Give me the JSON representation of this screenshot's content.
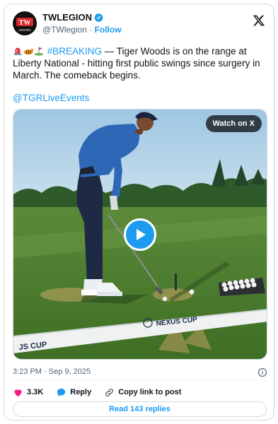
{
  "author": {
    "display_name": "TWLEGION",
    "handle": "@TWlegion",
    "separator": "·",
    "follow_label": "Follow",
    "avatar_lines": [
      "TW",
      "LEGION"
    ]
  },
  "tweet": {
    "hashtag": "#BREAKING",
    "body": " — Tiger Woods is on the range at Liberty National - hitting first public swings since surgery in March. The comeback begins.",
    "mention": "@TGRLiveEvents",
    "emojis": [
      "rotating-light-icon",
      "tiger-icon",
      "golf-flag-icon"
    ]
  },
  "media": {
    "watch_label": "Watch on X",
    "banner_text_left": "JS CUP",
    "banner_text_right": "NEXUS CUP"
  },
  "meta": {
    "time": "3:23 PM · Sep 9, 2025"
  },
  "actions": {
    "likes": "3.3K",
    "reply_label": "Reply",
    "copy_label": "Copy link to post"
  },
  "replies_button": "Read 143 replies",
  "colors": {
    "accent": "#1d9bf0",
    "like_red": "#f91880",
    "text": "#0f1419",
    "muted": "#536471"
  }
}
